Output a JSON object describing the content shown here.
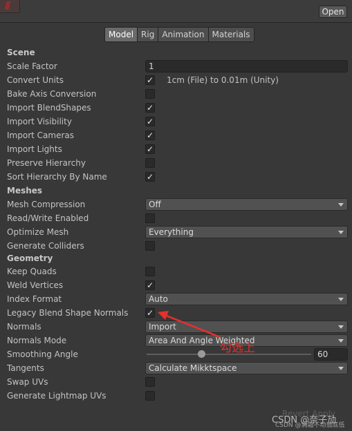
{
  "header": {
    "open_label": "Open"
  },
  "tabs": [
    {
      "label": "Model",
      "active": true
    },
    {
      "label": "Rig",
      "active": false
    },
    {
      "label": "Animation",
      "active": false
    },
    {
      "label": "Materials",
      "active": false
    }
  ],
  "scene": {
    "title": "Scene",
    "scale_factor": {
      "label": "Scale Factor",
      "value": "1"
    },
    "convert_units": {
      "label": "Convert Units",
      "checked": true,
      "note": "1cm (File) to 0.01m (Unity)"
    },
    "bake_axis_conversion": {
      "label": "Bake Axis Conversion",
      "checked": false
    },
    "import_blendshapes": {
      "label": "Import BlendShapes",
      "checked": true
    },
    "import_visibility": {
      "label": "Import Visibility",
      "checked": true
    },
    "import_cameras": {
      "label": "Import Cameras",
      "checked": true
    },
    "import_lights": {
      "label": "Import Lights",
      "checked": true
    },
    "preserve_hierarchy": {
      "label": "Preserve Hierarchy",
      "checked": false
    },
    "sort_hierarchy_by_name": {
      "label": "Sort Hierarchy By Name",
      "checked": true
    }
  },
  "meshes": {
    "title": "Meshes",
    "mesh_compression": {
      "label": "Mesh Compression",
      "value": "Off"
    },
    "read_write_enabled": {
      "label": "Read/Write Enabled",
      "checked": false
    },
    "optimize_mesh": {
      "label": "Optimize Mesh",
      "value": "Everything"
    },
    "generate_colliders": {
      "label": "Generate Colliders",
      "checked": false
    }
  },
  "geometry": {
    "title": "Geometry",
    "keep_quads": {
      "label": "Keep Quads",
      "checked": false
    },
    "weld_vertices": {
      "label": "Weld Vertices",
      "checked": true
    },
    "index_format": {
      "label": "Index Format",
      "value": "Auto"
    },
    "legacy_blend_shape_normals": {
      "label": "Legacy Blend Shape Normals",
      "checked": true
    },
    "normals": {
      "label": "Normals",
      "value": "Import"
    },
    "normals_mode": {
      "label": "Normals Mode",
      "value": "Area And Angle Weighted"
    },
    "smoothing_angle": {
      "label": "Smoothing Angle",
      "value": "60",
      "slider_fraction": 0.333
    },
    "tangents": {
      "label": "Tangents",
      "value": "Calculate Mikktspace"
    },
    "swap_uvs": {
      "label": "Swap UVs",
      "checked": false
    },
    "generate_lightmap_uvs": {
      "label": "Generate Lightmap UVs",
      "checked": false
    }
  },
  "annotation": {
    "text": "勾选上",
    "color": "#e8302c"
  },
  "footer": {
    "revert_label": "Revert  Apply",
    "watermark": "CSDN @奈子劢",
    "watermark_sub": "CSDN @满霜不动翡底低"
  },
  "check_glyph": "✓",
  "colors": {
    "background": "#383838",
    "accent": "#e8302c",
    "active_tab": "#6a6a6a"
  }
}
